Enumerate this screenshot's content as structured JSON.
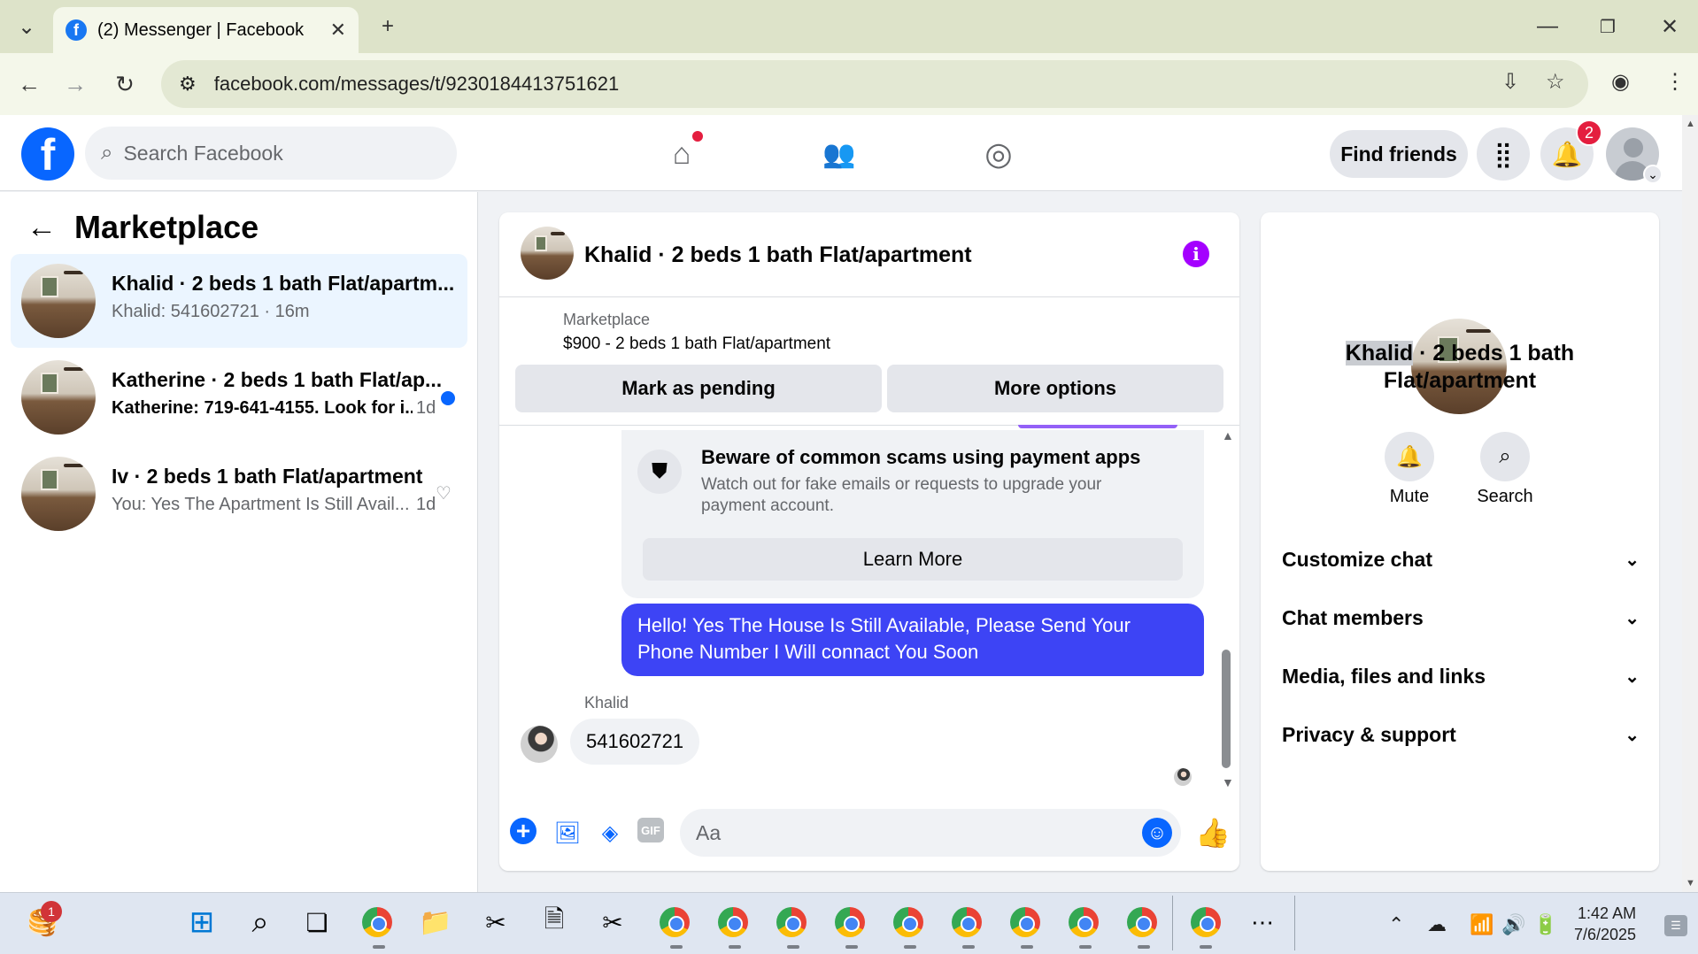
{
  "browser": {
    "tab_title": "(2) Messenger | Facebook",
    "url": "facebook.com/messages/t/9230184413751621"
  },
  "fb_header": {
    "search_placeholder": "Search Facebook",
    "find_friends": "Find friends",
    "notification_count": "2"
  },
  "left_panel": {
    "title": "Marketplace",
    "conversations": [
      {
        "name": "Khalid · 2 beds 1 bath Flat/apartm...",
        "preview": "Khalid: 541602721 · 16m",
        "active": true,
        "unread": false
      },
      {
        "name": "Katherine · 2 beds 1 bath Flat/ap...",
        "preview": "Katherine: 719-641-4155. Look for i...",
        "time": "1d",
        "active": false,
        "unread": true
      },
      {
        "name": "Iv · 2 beds 1 bath Flat/apartment",
        "preview": "You: Yes The Apartment Is Still Avail...",
        "time": "1d",
        "active": false,
        "unread": false
      }
    ]
  },
  "chat": {
    "title": "Khalid · 2 beds 1 bath Flat/apartment",
    "marketplace_label": "Marketplace",
    "listing": "$900 - 2 beds 1 bath Flat/apartment",
    "mark_pending": "Mark as pending",
    "more_options": "More options",
    "scam_title": "Beware of common scams using payment apps",
    "scam_body": "Watch out for fake emails or requests to upgrade your payment account.",
    "learn_more": "Learn More",
    "outgoing_message": "Hello! Yes The House  Is Still Available, Please Send Your Phone Number I Will connact You Soon",
    "sender_name": "Khalid",
    "incoming_message": "541602721",
    "compose_placeholder": "Aa",
    "gif_label": "GIF"
  },
  "right_panel": {
    "title_highlight": "Khalid",
    "title_rest": " · 2 beds 1 bath Flat/apartment",
    "mute": "Mute",
    "search": "Search",
    "sections": [
      "Customize chat",
      "Chat members",
      "Media, files and links",
      "Privacy & support"
    ]
  },
  "taskbar": {
    "badge": "1",
    "time": "1:42 AM",
    "date": "7/6/2025"
  },
  "colors": {
    "fb_blue": "#0866ff",
    "outgoing_bubble": "#3d44f5",
    "info_purple": "#a400ff",
    "badge_red": "#e41e3f"
  }
}
